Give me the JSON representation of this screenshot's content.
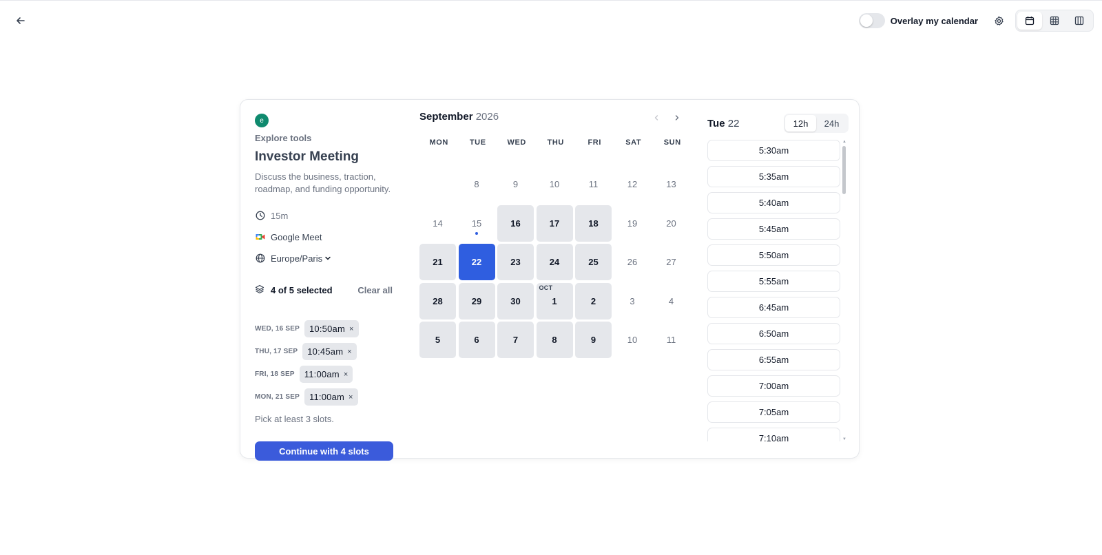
{
  "topbar": {
    "overlay_label": "Overlay my calendar",
    "overlay_on": false,
    "views": [
      {
        "name": "month-view",
        "active": true
      },
      {
        "name": "week-view",
        "active": false
      },
      {
        "name": "column-view",
        "active": false
      }
    ]
  },
  "event": {
    "org_initial": "e",
    "org_name": "Explore tools",
    "title": "Investor Meeting",
    "description": "Discuss the business, traction, roadmap, and funding opportunity.",
    "duration": "15m",
    "location": "Google Meet",
    "timezone": "Europe/Paris"
  },
  "selection": {
    "summary": "4 of 5 selected",
    "clear_label": "Clear all",
    "slots": [
      {
        "day": "WED, 16 SEP",
        "time": "10:50am"
      },
      {
        "day": "THU, 17 SEP",
        "time": "10:45am"
      },
      {
        "day": "FRI, 18 SEP",
        "time": "11:00am"
      },
      {
        "day": "MON, 21 SEP",
        "time": "11:00am"
      }
    ],
    "remove_glyph": "×",
    "hint": "Pick at least 3 slots.",
    "continue_label": "Continue with 4 slots"
  },
  "calendar": {
    "month": "September",
    "year": "2026",
    "weekdays": [
      "MON",
      "TUE",
      "WED",
      "THU",
      "FRI",
      "SAT",
      "SUN"
    ],
    "days": [
      {
        "label": "",
        "state": "empty"
      },
      {
        "label": "8",
        "state": "off"
      },
      {
        "label": "9",
        "state": "off"
      },
      {
        "label": "10",
        "state": "off"
      },
      {
        "label": "11",
        "state": "off"
      },
      {
        "label": "12",
        "state": "off"
      },
      {
        "label": "13",
        "state": "off"
      },
      {
        "label": "14",
        "state": "off"
      },
      {
        "label": "15",
        "state": "off",
        "today": true
      },
      {
        "label": "16",
        "state": "avail"
      },
      {
        "label": "17",
        "state": "avail"
      },
      {
        "label": "18",
        "state": "avail"
      },
      {
        "label": "19",
        "state": "off"
      },
      {
        "label": "20",
        "state": "off"
      },
      {
        "label": "21",
        "state": "avail"
      },
      {
        "label": "22",
        "state": "selected"
      },
      {
        "label": "23",
        "state": "avail"
      },
      {
        "label": "24",
        "state": "avail"
      },
      {
        "label": "25",
        "state": "avail"
      },
      {
        "label": "26",
        "state": "off"
      },
      {
        "label": "27",
        "state": "off"
      },
      {
        "label": "28",
        "state": "avail"
      },
      {
        "label": "29",
        "state": "avail"
      },
      {
        "label": "30",
        "state": "avail"
      },
      {
        "label": "1",
        "state": "avail",
        "month_tag": "OCT"
      },
      {
        "label": "2",
        "state": "avail"
      },
      {
        "label": "3",
        "state": "off"
      },
      {
        "label": "4",
        "state": "off"
      },
      {
        "label": "5",
        "state": "avail"
      },
      {
        "label": "6",
        "state": "avail"
      },
      {
        "label": "7",
        "state": "avail"
      },
      {
        "label": "8",
        "state": "avail"
      },
      {
        "label": "9",
        "state": "avail"
      },
      {
        "label": "10",
        "state": "off"
      },
      {
        "label": "11",
        "state": "off"
      }
    ]
  },
  "times": {
    "day_of_week": "Tue",
    "day_number": "22",
    "format_options": [
      "12h",
      "24h"
    ],
    "format_selected": "12h",
    "slots": [
      "5:30am",
      "5:35am",
      "5:40am",
      "5:45am",
      "5:50am",
      "5:55am",
      "6:45am",
      "6:50am",
      "6:55am",
      "7:00am",
      "7:05am",
      "7:10am"
    ]
  },
  "colors": {
    "accent": "#2f5ee0",
    "button": "#3b5bdb",
    "org_avatar": "#0f8a6e",
    "available_day": "#e5e7eb"
  }
}
